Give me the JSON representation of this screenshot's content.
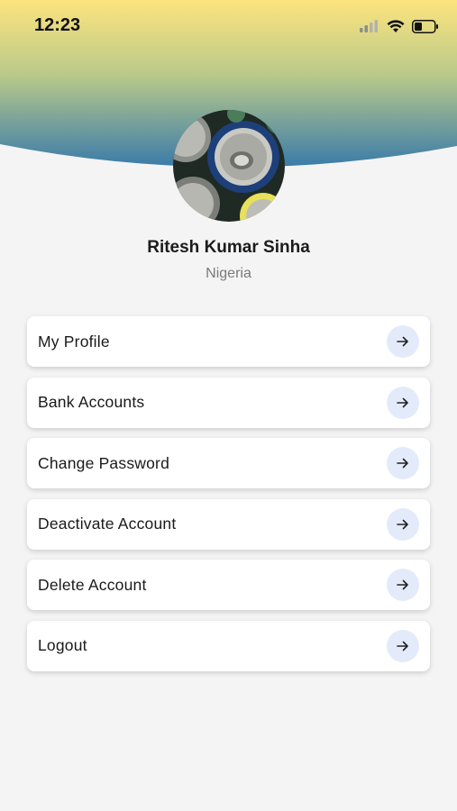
{
  "status_bar": {
    "time": "12:23",
    "icons": [
      "signal-icon",
      "wifi-icon",
      "battery-icon"
    ]
  },
  "colors": {
    "header_top": "#fde680",
    "header_bottom": "#3d7ea8",
    "background": "#f4f4f4",
    "arrow_button_bg": "#e3ebfb"
  },
  "profile": {
    "name": "Ritesh Kumar Sinha",
    "country": "Nigeria"
  },
  "menu": {
    "items": [
      {
        "label": "My Profile",
        "icon": "arrow-right-icon"
      },
      {
        "label": "Bank Accounts",
        "icon": "arrow-right-icon"
      },
      {
        "label": "Change Password",
        "icon": "arrow-right-icon"
      },
      {
        "label": "Deactivate Account",
        "icon": "arrow-right-icon"
      },
      {
        "label": "Delete Account",
        "icon": "arrow-right-icon"
      },
      {
        "label": "Logout",
        "icon": "arrow-right-icon"
      }
    ]
  }
}
